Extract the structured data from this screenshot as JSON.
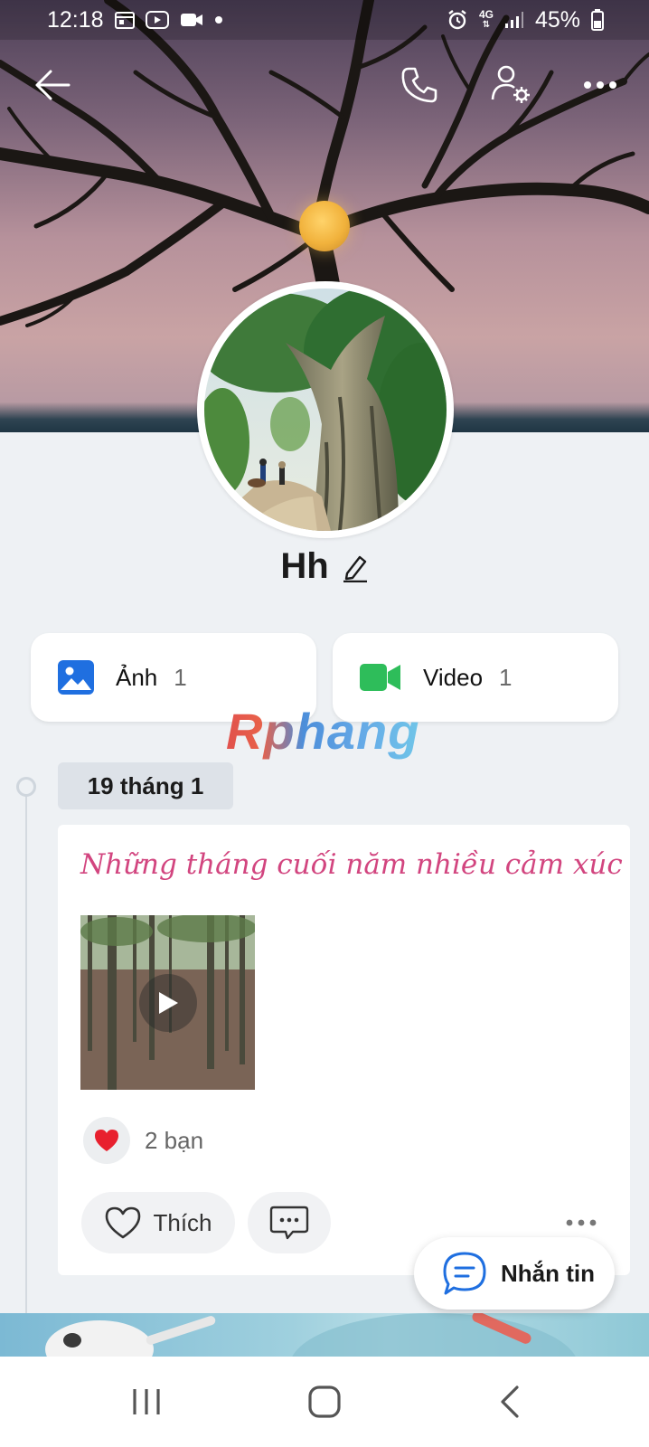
{
  "status_bar": {
    "time": "12:18",
    "network": "4G",
    "battery": "45%",
    "icons": [
      "calendar-icon",
      "youtube-icon",
      "video-camera-icon",
      "notification-dot",
      "alarm-icon",
      "signal-icon",
      "battery-icon"
    ]
  },
  "header": {
    "actions": [
      "back-arrow-icon",
      "phone-icon",
      "user-settings-icon",
      "more-icon"
    ]
  },
  "profile": {
    "name": "Hh"
  },
  "media": {
    "photos": {
      "label": "Ảnh",
      "count": "1",
      "color": "#1f6fe0"
    },
    "videos": {
      "label": "Video",
      "count": "1",
      "color": "#2ebd5a"
    }
  },
  "watermark": "Rphang",
  "timeline": {
    "date": "19 tháng 1",
    "post": {
      "text": "Những tháng cuối năm nhiều cảm xúc",
      "text_color": "#d2457f",
      "reaction_count": "2 bạn",
      "like_label": "Thích"
    }
  },
  "fab": {
    "label": "Nhắn tin"
  },
  "nav_bar": {
    "buttons": [
      "recent-apps",
      "home",
      "back"
    ]
  }
}
